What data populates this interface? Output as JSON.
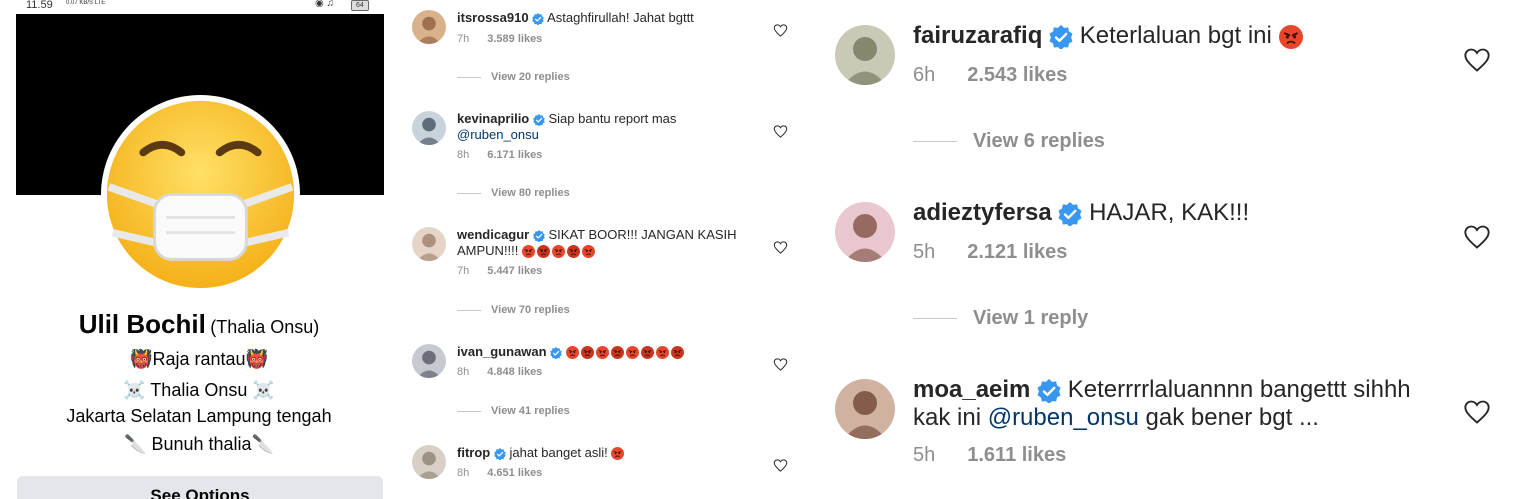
{
  "profile": {
    "status": {
      "time": "11.59",
      "signal": "0.07 KB/S LTE",
      "battery": "64"
    },
    "name": "Ulil Bochil",
    "alt_name": "(Thalia Onsu)",
    "bio": [
      "👹Raja  rantau👹",
      "☠️ Thalia Onsu ☠️",
      "Jakarta Selatan Lampung tengah",
      "🔪  Bunuh thalia🔪"
    ],
    "see_options": "See Options"
  },
  "comments_left": [
    {
      "user": "itsrossa910",
      "text": "Astaghfirullah! Jahat bgttt",
      "time": "7h",
      "likes": "3.589 likes",
      "view": "View 20 replies",
      "emoji": 0
    },
    {
      "user": "kevinaprilio",
      "text": "Siap bantu report mas",
      "mention": "@ruben_onsu",
      "time": "8h",
      "likes": "6.171 likes",
      "view": "View 80 replies",
      "emoji": 0
    },
    {
      "user": "wendicagur",
      "text": "SIKAT BOOR!!! JANGAN KASIH AMPUN!!!!",
      "time": "7h",
      "likes": "5.447 likes",
      "view": "View 70 replies",
      "emoji": 5
    },
    {
      "user": "ivan_gunawan",
      "text": "",
      "time": "8h",
      "likes": "4.848 likes",
      "view": "View 41 replies",
      "emoji": 8
    },
    {
      "user": "fitrop",
      "text": "jahat banget asli!",
      "time": "8h",
      "likes": "4.651 likes",
      "view": "",
      "emoji": 1
    }
  ],
  "comments_right": [
    {
      "user": "fairuzarafiq",
      "text": "Keterlaluan bgt ini",
      "time": "6h",
      "likes": "2.543 likes",
      "view": "View 6 replies",
      "emoji": 1
    },
    {
      "user": "adieztyfersa",
      "text": "HAJAR, KAK!!!",
      "time": "5h",
      "likes": "2.121 likes",
      "view": "View 1 reply",
      "emoji": 0
    },
    {
      "user": "moa_aeim",
      "text": "Keterrrrlaluannnn bangettt sihhh kak ini",
      "mention": "@ruben_onsu",
      "text2": "gak bener bgt ...",
      "time": "5h",
      "likes": "1.611 likes",
      "view": "",
      "emoji": 0
    }
  ],
  "colors": {
    "verified": "#3897f0",
    "angry": "#e8462b",
    "muted": "#8e8e8e",
    "mention": "#00376b"
  }
}
